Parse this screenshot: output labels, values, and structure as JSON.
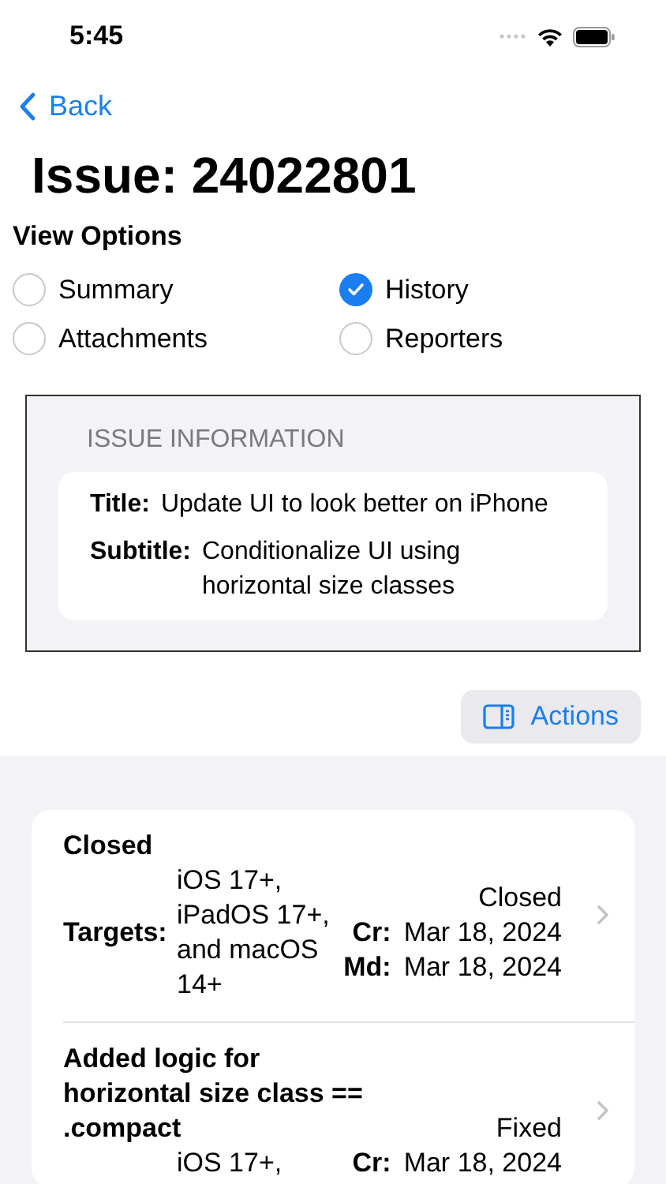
{
  "status_bar": {
    "time": "5:45"
  },
  "nav": {
    "back": "Back"
  },
  "title": "Issue: 24022801",
  "view_options": {
    "label": "View Options",
    "options": [
      {
        "label": "Summary",
        "selected": false
      },
      {
        "label": "History",
        "selected": true
      },
      {
        "label": "Attachments",
        "selected": false
      },
      {
        "label": "Reporters",
        "selected": false
      }
    ]
  },
  "issue_information": {
    "header": "ISSUE INFORMATION",
    "fields": [
      {
        "label": "Title:",
        "value": "Update UI to look better on iPhone"
      },
      {
        "label": "Subtitle:",
        "value": "Conditionalize UI using horizontal size classes"
      }
    ]
  },
  "actions_button": "Actions",
  "history": [
    {
      "kind": "stacked",
      "title": "Closed",
      "status": "Closed",
      "targets_label": "Targets:",
      "targets": "iOS 17+, iPadOS 17+, and macOS 14+",
      "dates": [
        {
          "label": "Cr:",
          "value": "Mar 18, 2024"
        },
        {
          "label": "Md:",
          "value": "Mar 18, 2024"
        }
      ]
    },
    {
      "kind": "inline",
      "title": "Added logic for horizontal size class == .compact",
      "status": "Fixed",
      "targets": "iOS 17+,",
      "dates": [
        {
          "label": "Cr:",
          "value": "Mar 18, 2024"
        }
      ]
    }
  ]
}
